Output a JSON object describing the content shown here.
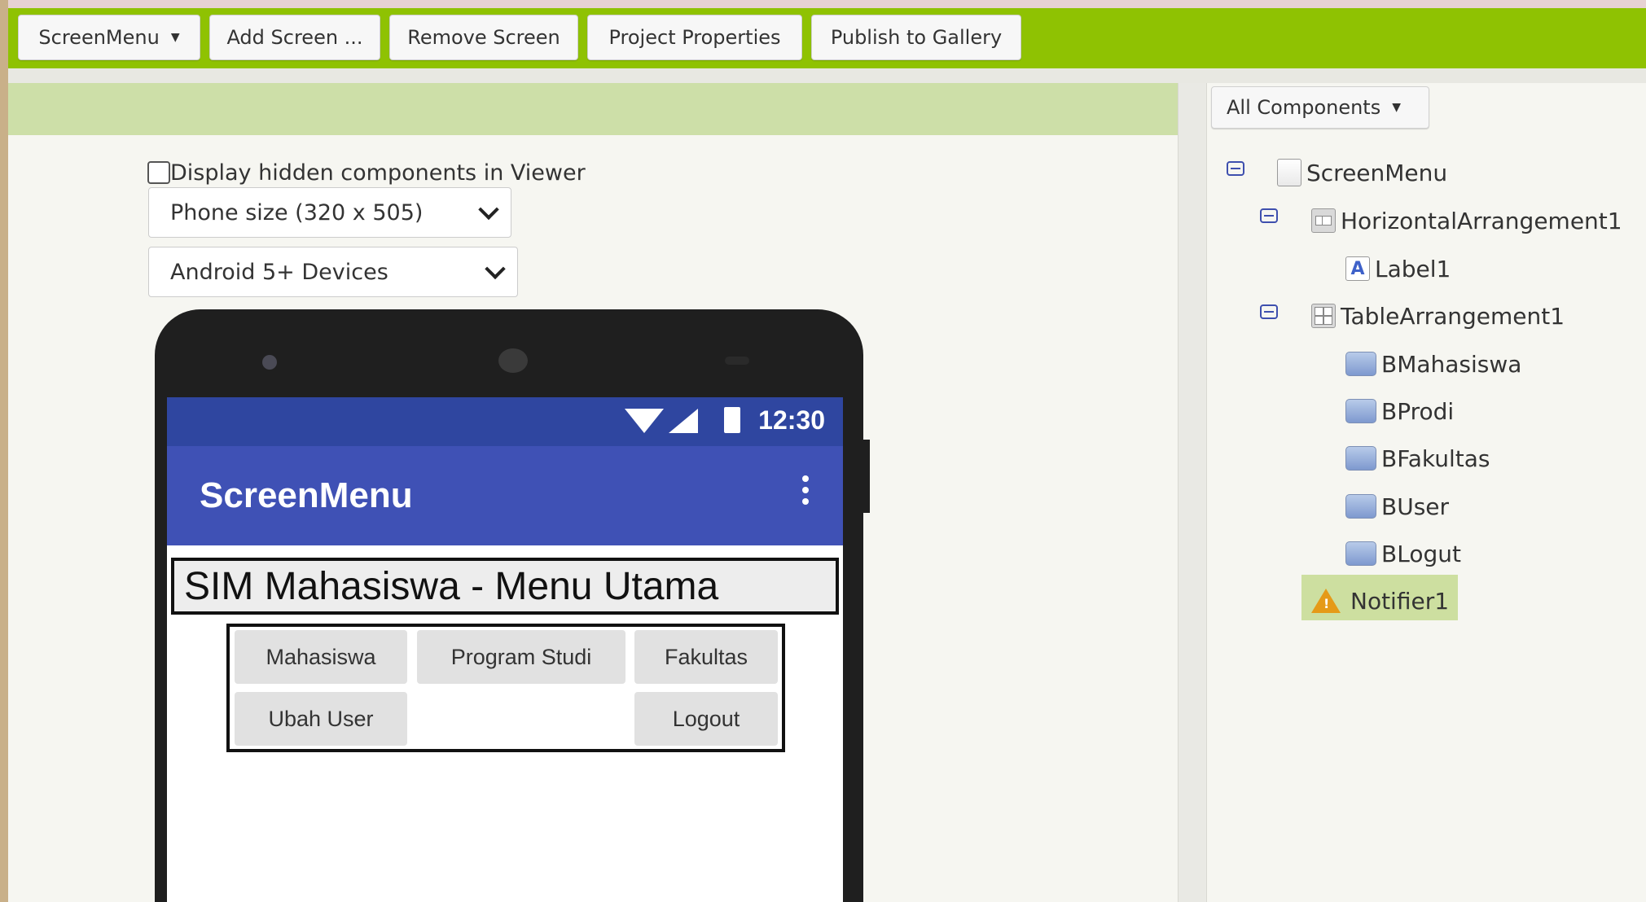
{
  "toolbar": {
    "screen_menu": "ScreenMenu",
    "add_screen": "Add Screen ...",
    "remove_screen": "Remove Screen",
    "project_properties": "Project Properties",
    "publish_gallery": "Publish to Gallery"
  },
  "viewer": {
    "hidden_label": "Display hidden components in Viewer",
    "hidden_checked": false,
    "phone_size": "Phone size (320 x 505)",
    "android_version": "Android 5+ Devices"
  },
  "phone": {
    "clock": "12:30",
    "app_title": "ScreenMenu",
    "label_text": "SIM Mahasiswa - Menu Utama",
    "buttons": {
      "mahasiswa": "Mahasiswa",
      "program_studi": "Program Studi",
      "fakultas": "Fakultas",
      "ubah_user": "Ubah User",
      "logout": "Logout"
    }
  },
  "components": {
    "filter": "All Components",
    "tree": {
      "screen": "ScreenMenu",
      "harr": "HorizontalArrangement1",
      "label1": "Label1",
      "tarr": "TableArrangement1",
      "bmahasiswa": "BMahasiswa",
      "bprodi": "BProdi",
      "bfakultas": "BFakultas",
      "buser": "BUser",
      "blogut": "BLogut",
      "notifier": "Notifier1"
    }
  },
  "colors": {
    "toolbar": "#8fc202",
    "viewer_bar": "#cddfa8",
    "statusbar": "#2f46a0",
    "appbar": "#3f51b5",
    "selection": "#cddfa0"
  }
}
